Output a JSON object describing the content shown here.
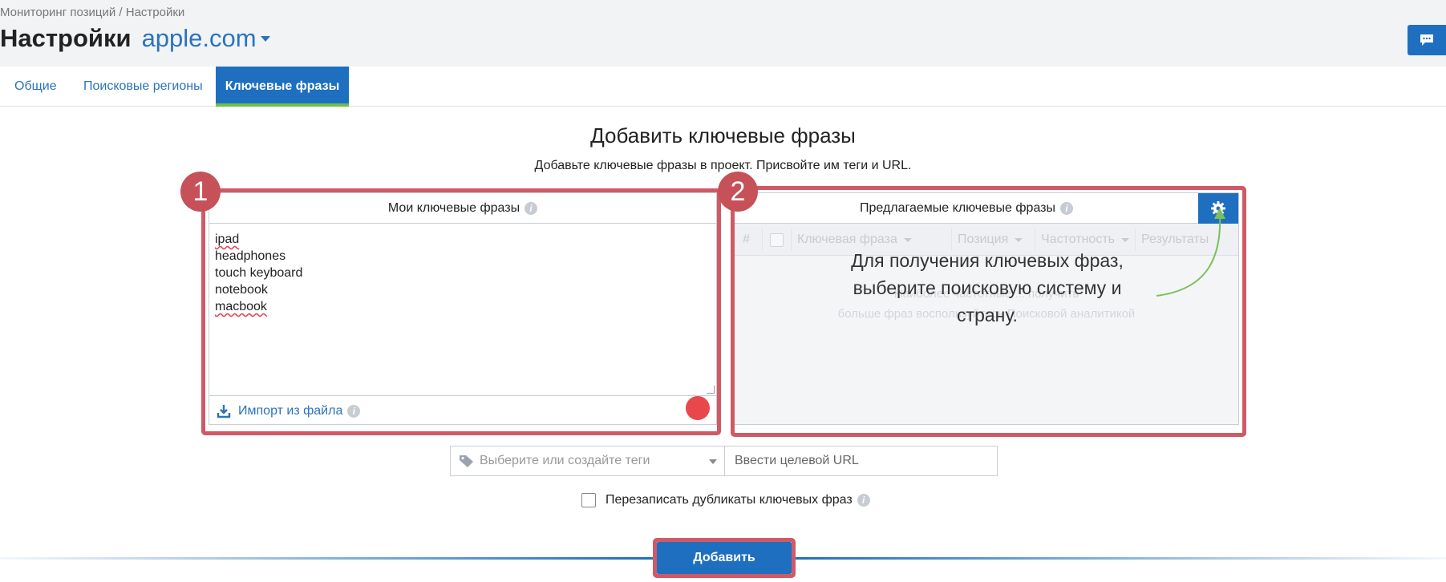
{
  "header": {
    "breadcrumb": "Мониторинг позиций / Настройки",
    "title": "Настройки",
    "project": "apple.com"
  },
  "tabs": [
    {
      "label": "Общие",
      "active": false
    },
    {
      "label": "Поисковые регионы",
      "active": false
    },
    {
      "label": "Ключевые фразы",
      "active": true
    }
  ],
  "section": {
    "title": "Добавить ключевые фразы",
    "subtitle": "Добавьте ключевые фразы в проект. Присвойте им теги и URL."
  },
  "annotations": {
    "badge1": "1",
    "badge2": "2"
  },
  "my_keywords": {
    "header": "Мои ключевые фразы",
    "items": [
      "ipad",
      "headphones",
      "touch keyboard",
      "notebook",
      "macbook"
    ],
    "import_label": "Импорт из файла"
  },
  "suggested": {
    "header": "Предлагаемые ключевые фразы",
    "columns": {
      "num": "#",
      "keyword": "Ключевая фраза",
      "position": "Позиция",
      "frequency": "Частотность",
      "results": "Результаты"
    },
    "faded_line1": "Наиболее частотные ... получить",
    "faded_line2": "больше фраз воспользуйтесь Поисковой аналитикой",
    "overlay_hint": "Для получения ключевых фраз, выберите поисковую систему и страну."
  },
  "form": {
    "tags_placeholder": "Выберите или создайте теги",
    "url_placeholder": "Ввести целевой URL",
    "overwrite_label": "Перезаписать дубликаты ключевых фраз",
    "add_button": "Добавить"
  },
  "colors": {
    "accent": "#1e6fc0",
    "highlight": "#cf5a66",
    "active_tab_underline": "#6cbf4a"
  }
}
